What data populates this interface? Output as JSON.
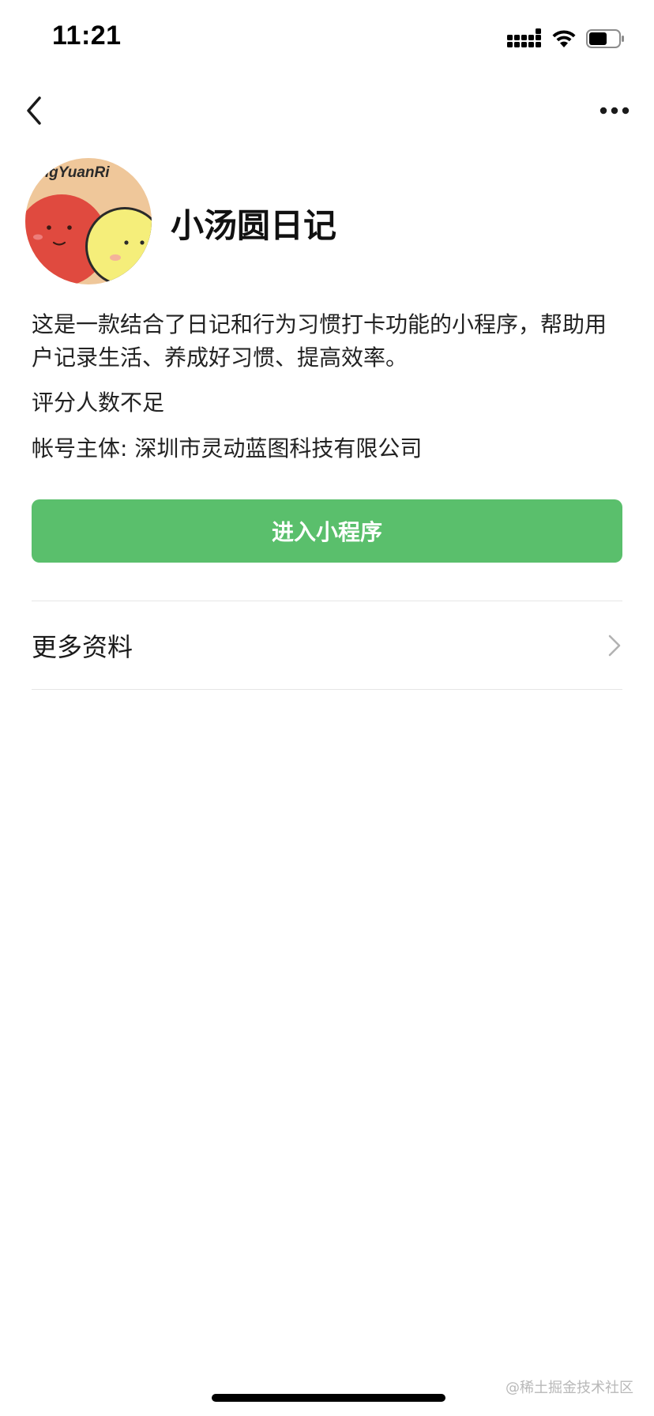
{
  "status_bar": {
    "time": "11:21"
  },
  "nav": {
    "back_icon": "chevron-left-icon",
    "more_icon": "more-dots-icon"
  },
  "profile": {
    "avatar_text": "YangYuanRi",
    "app_name": "小汤圆日记"
  },
  "info": {
    "description": "这是一款结合了日记和行为习惯打卡功能的小程序，帮助用户记录生活、养成好习惯、提高效率。",
    "rating": "评分人数不足",
    "account_subject": "帐号主体: 深圳市灵动蓝图科技有限公司"
  },
  "actions": {
    "enter_label": "进入小程序"
  },
  "more_info": {
    "label": "更多资料"
  },
  "watermark": "@稀土掘金技术社区",
  "colors": {
    "accent": "#5ABF6C",
    "divider": "#e6e6e6",
    "avatar_bg": "#EFC79A",
    "avatar_red": "#E04A3F",
    "avatar_yellow": "#F5EE7A"
  }
}
